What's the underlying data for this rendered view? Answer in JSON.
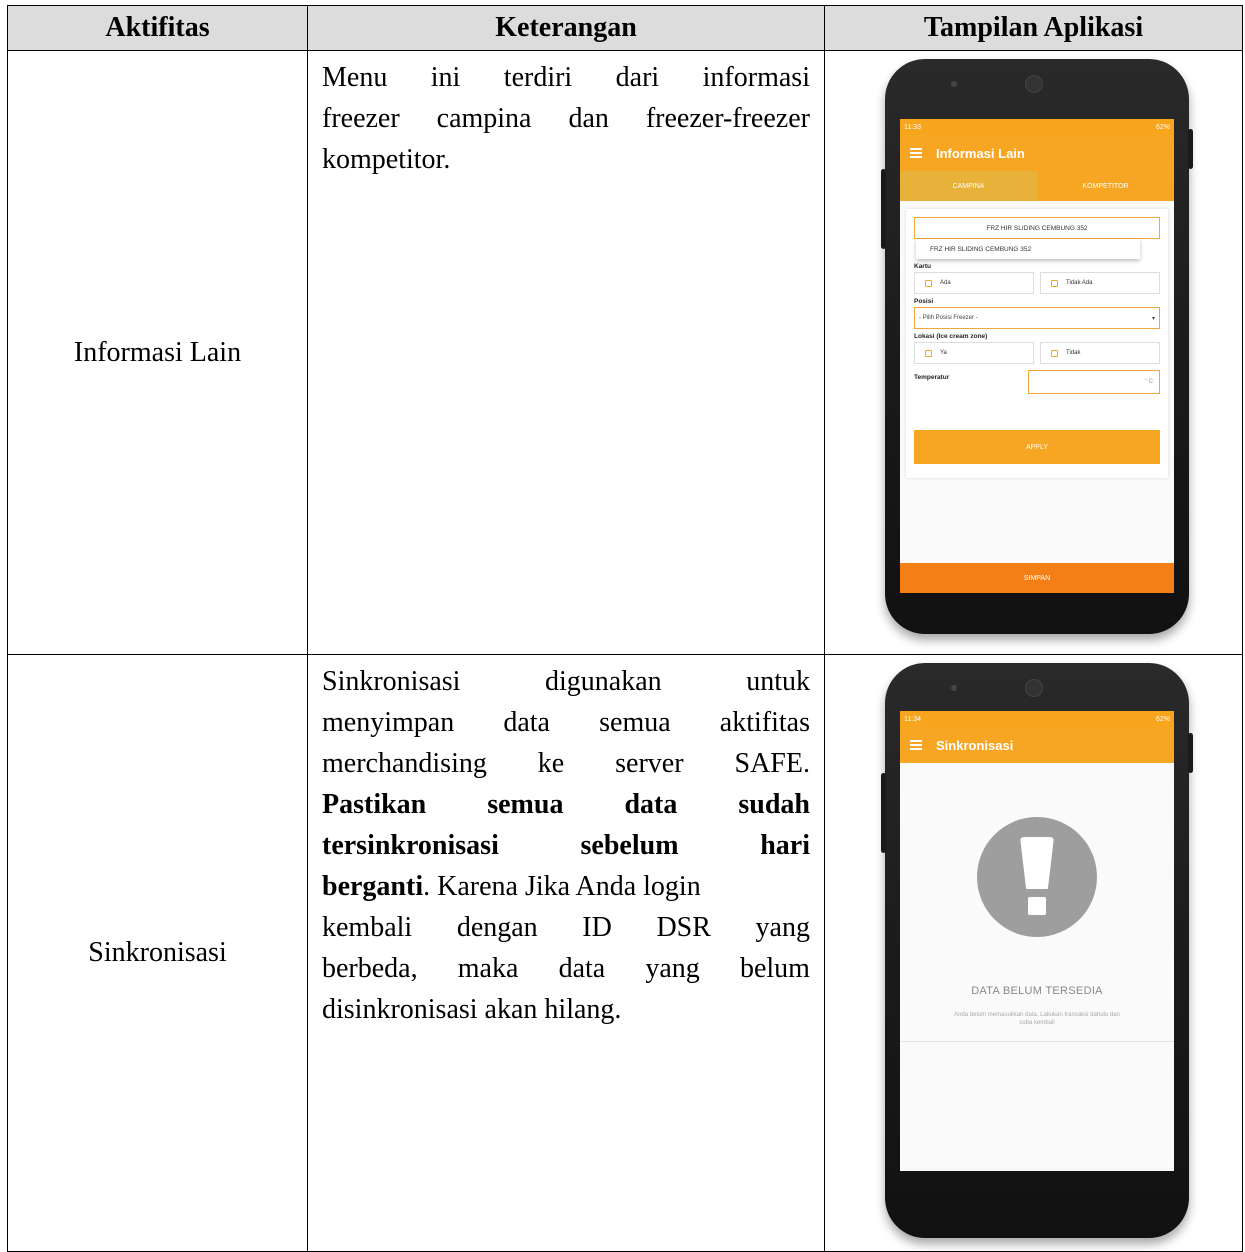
{
  "table": {
    "headers": [
      "Aktifitas",
      "Keterangan",
      "Tampilan Aplikasi"
    ]
  },
  "rows": [
    {
      "activity": "Informasi Lain",
      "desc_lines": [
        [
          "Menu",
          "ini",
          "terdiri",
          "dari",
          "informasi"
        ],
        [
          "freezer",
          "campina",
          "dan",
          "freezer-freezer"
        ],
        [
          "kompetitor."
        ]
      ]
    },
    {
      "activity": "Sinkronisasi",
      "desc_lines": [
        [
          "Sinkronisasi",
          "digunakan",
          "untuk"
        ],
        [
          "menyimpan",
          "data",
          "semua",
          "aktifitas"
        ],
        [
          "merchandising",
          "ke",
          "server",
          "SAFE."
        ]
      ],
      "desc_bold_lines": [
        [
          "Pastikan",
          "semua",
          "data",
          "sudah"
        ],
        [
          "tersinkronisasi",
          "sebelum",
          "hari"
        ]
      ],
      "desc_bold_tail": "berganti",
      "desc_after_bold": ". Karena Jika Anda login",
      "desc_tail_lines": [
        [
          "kembali",
          "dengan",
          "ID",
          "DSR",
          "yang"
        ],
        [
          "berbeda,",
          "maka",
          "data",
          "yang",
          "belum"
        ],
        [
          "disinkronisasi akan hilang."
        ]
      ]
    }
  ],
  "phone1": {
    "status_time": "11:33",
    "status_right": "62%",
    "title": "Informasi Lain",
    "tabs": [
      "CAMPINA",
      "KOMPETITOR"
    ],
    "dropdown_value": "FRZ HIR SLIDING CEMBUNG 352",
    "dropdown_option": "FRZ HIR SLIDING CEMBUNG 352",
    "kartu_label": "Kartu",
    "kartu_options": [
      "Ada",
      "Tidak Ada"
    ],
    "posisi_label": "Posisi",
    "posisi_placeholder": "- Pilih Posisi Freezer -",
    "lokasi_label": "Lokasi (Ice cream zone)",
    "lokasi_options": [
      "Ya",
      "Tidak"
    ],
    "temp_label": "Temperatur",
    "temp_unit": "° C",
    "apply": "APPLY",
    "simpan": "SIMPAN"
  },
  "phone2": {
    "status_time": "11:34",
    "status_right": "62%",
    "title": "Sinkronisasi",
    "empty_title": "DATA BELUM TERSEDIA",
    "empty_sub": "Anda belum memasukkan data. Lakukan transaksi dahulu dan coba kembali"
  }
}
